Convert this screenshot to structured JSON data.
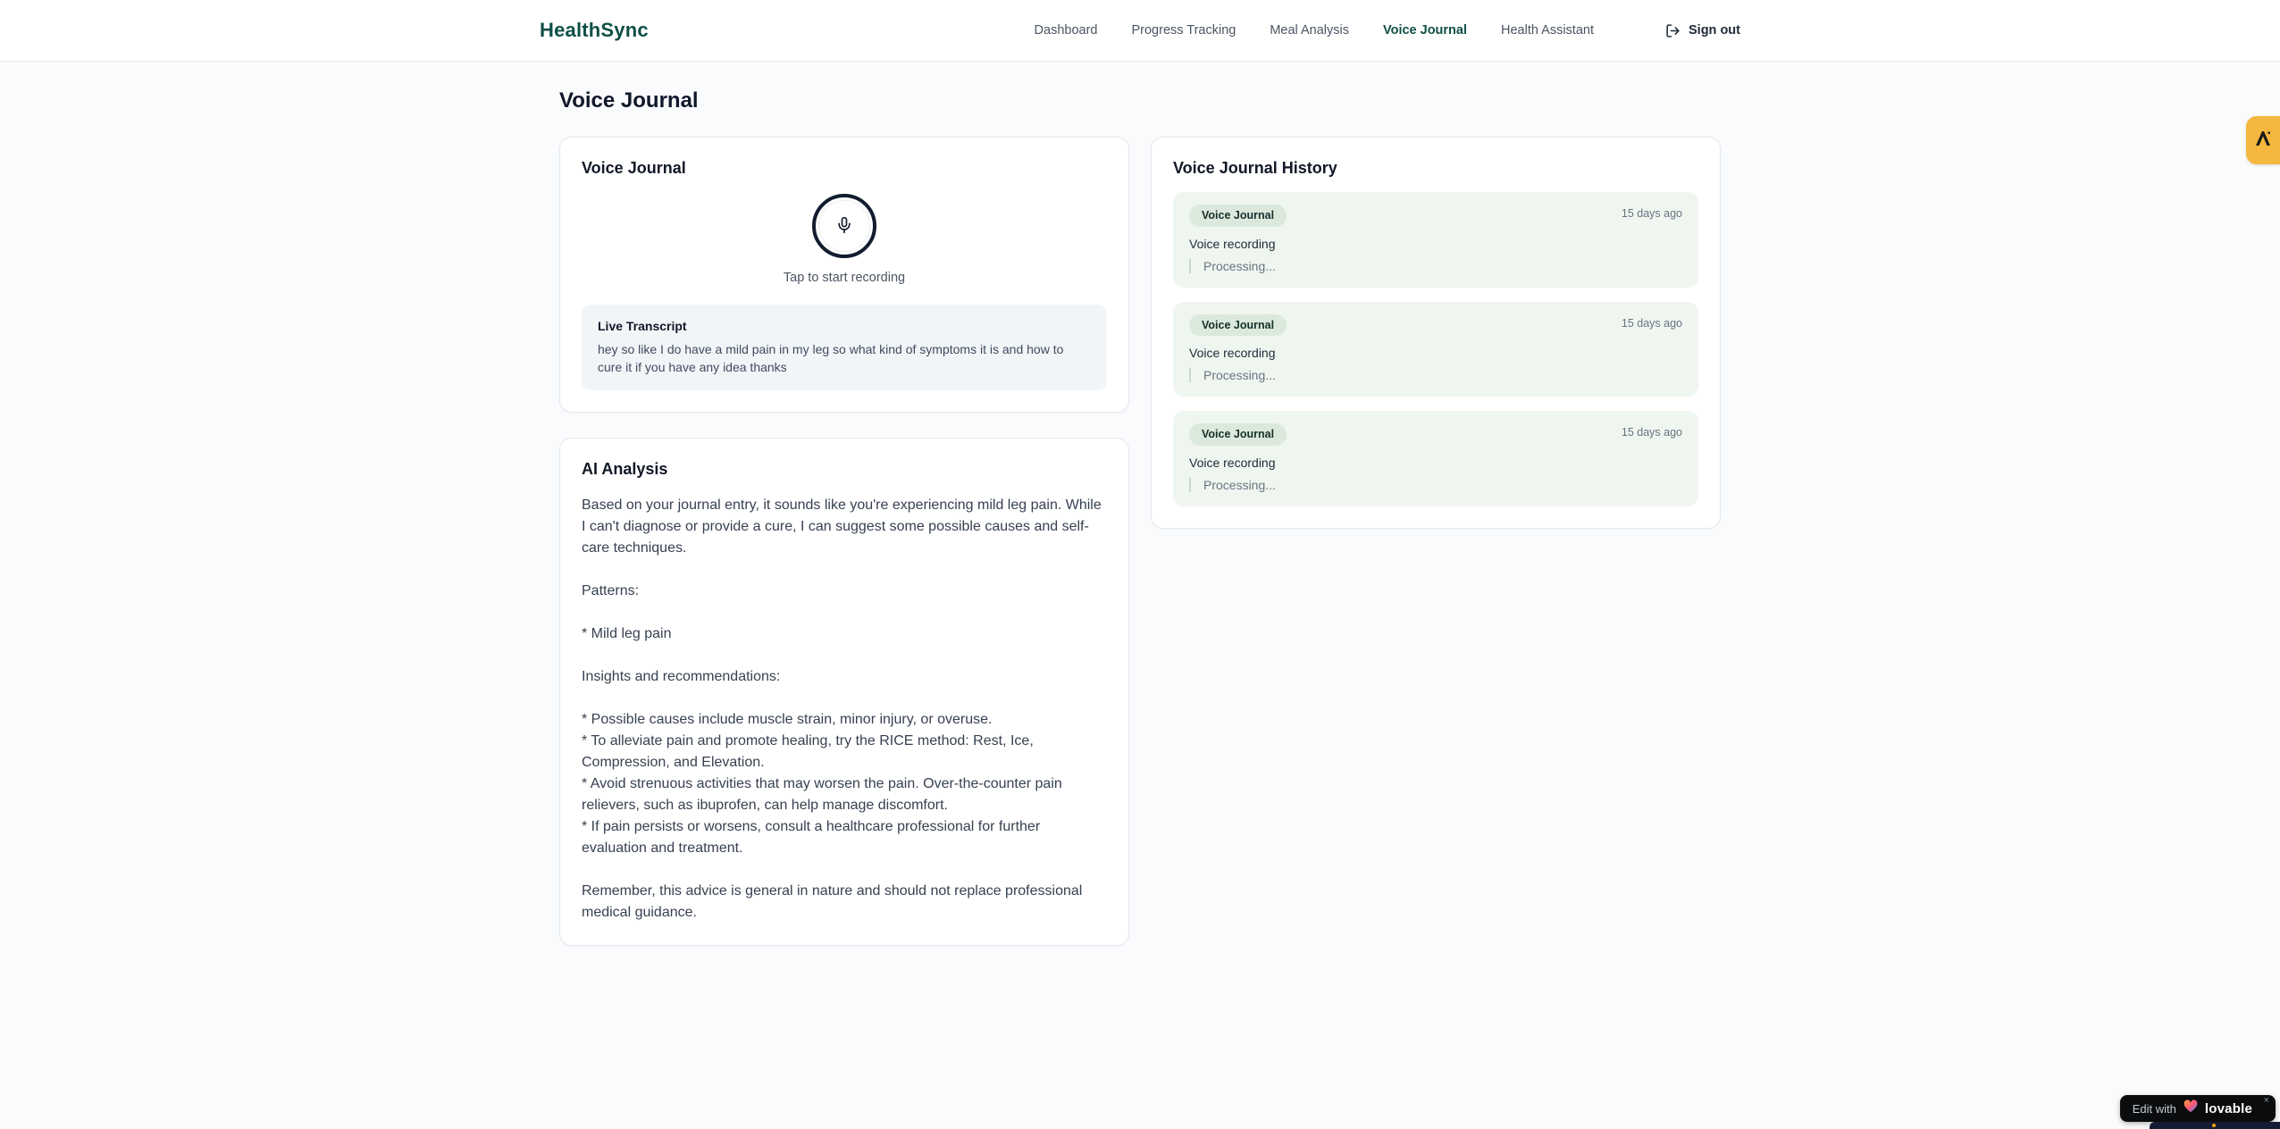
{
  "brand": {
    "name": "HealthSync"
  },
  "nav": {
    "items": [
      {
        "label": "Dashboard",
        "active": false
      },
      {
        "label": "Progress Tracking",
        "active": false
      },
      {
        "label": "Meal Analysis",
        "active": false
      },
      {
        "label": "Voice Journal",
        "active": true
      },
      {
        "label": "Health Assistant",
        "active": false
      }
    ],
    "sign_out_label": "Sign out"
  },
  "page": {
    "title": "Voice Journal"
  },
  "recorder_card": {
    "title": "Voice Journal",
    "tap_hint": "Tap to start recording",
    "transcript_title": "Live Transcript",
    "transcript_text": "hey so like I do have a mild pain in my leg so what kind of symptoms it is and how to cure it if you have any idea thanks"
  },
  "analysis_card": {
    "title": "AI Analysis",
    "body": "Based on your journal entry, it sounds like you're experiencing mild leg pain. While I can't diagnose or provide a cure, I can suggest some possible causes and self-care techniques.\n\nPatterns:\n\n* Mild leg pain\n\nInsights and recommendations:\n\n* Possible causes include muscle strain, minor injury, or overuse.\n* To alleviate pain and promote healing, try the RICE method: Rest, Ice, Compression, and Elevation.\n* Avoid strenuous activities that may worsen the pain. Over-the-counter pain relievers, such as ibuprofen, can help manage discomfort.\n* If pain persists or worsens, consult a healthcare professional for further evaluation and treatment.\n\nRemember, this advice is general in nature and should not replace professional medical guidance."
  },
  "history_panel": {
    "title": "Voice Journal History",
    "entries": [
      {
        "badge": "Voice Journal",
        "time": "15 days ago",
        "label": "Voice recording",
        "status": "Processing..."
      },
      {
        "badge": "Voice Journal",
        "time": "15 days ago",
        "label": "Voice recording",
        "status": "Processing..."
      },
      {
        "badge": "Voice Journal",
        "time": "15 days ago",
        "label": "Voice recording",
        "status": "Processing..."
      }
    ]
  },
  "widgets": {
    "edit_badge": {
      "prefix": "Edit with",
      "brand": "lovable",
      "close": "×"
    }
  },
  "icons": {
    "sign_out": "sign-out-icon",
    "microphone": "microphone-icon",
    "lovable_heart": "heart-icon",
    "side_tab_logo": "lambda-logo-icon",
    "close": "close-icon"
  },
  "colors": {
    "brand_teal": "#0f4f46",
    "page_bg": "#fafbfd",
    "card_border": "#e5e8ec",
    "history_entry_bg": "#eff6f0",
    "history_badge_bg": "#dbe8dc",
    "transcript_bg": "#f2f5f8",
    "side_tab_amber": "#f5b73d",
    "edit_badge_bg": "#0b0c0e",
    "mic_ring": "#111c2e"
  }
}
